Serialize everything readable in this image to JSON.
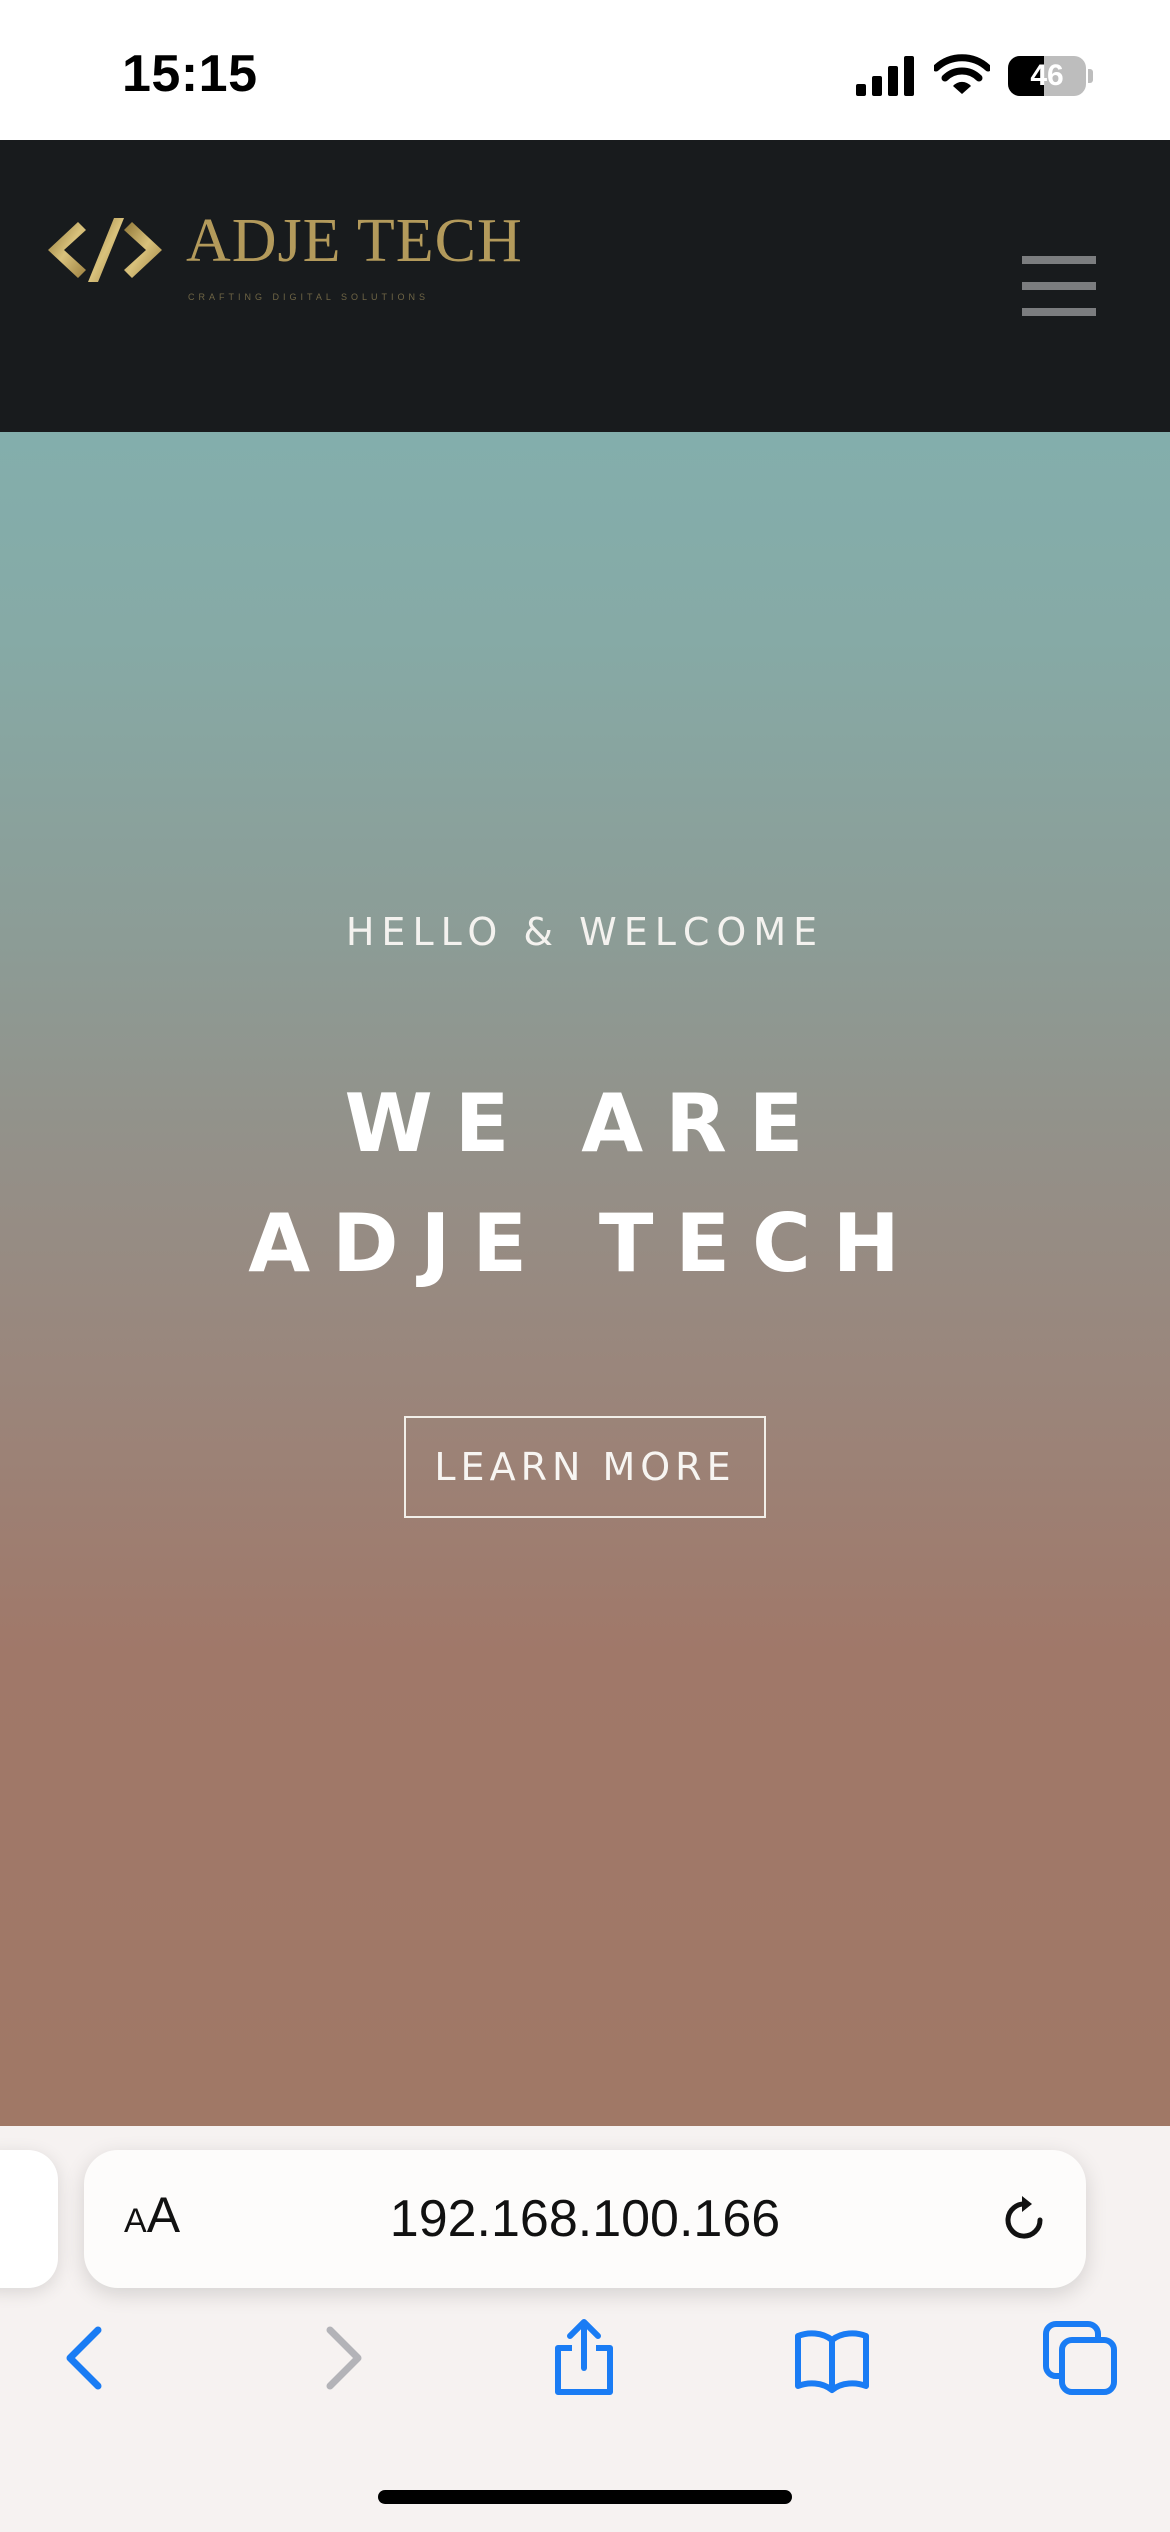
{
  "status_bar": {
    "time": "15:15",
    "battery_level": "46",
    "battery_fraction": 0.46,
    "icons": [
      "signal-icon",
      "wifi-icon",
      "battery-icon"
    ]
  },
  "header": {
    "logo_text": "ADJE TECH",
    "logo_tagline": "CRAFTING DIGITAL SOLUTIONS",
    "logo_icon": "code-brackets-icon",
    "menu_icon": "hamburger-menu-icon",
    "colors": {
      "background": "#181b1d",
      "gold": "#b39a5b",
      "menu": "#7b7d7f"
    }
  },
  "hero": {
    "eyebrow": "HELLO & WELCOME",
    "title": "WE ARE ADJE TECH",
    "cta_label": "LEARN MORE",
    "colors": {
      "top": "#83aeac",
      "bottom": "#a07866"
    }
  },
  "browser": {
    "text_size_small": "A",
    "text_size_big": "A",
    "url": "192.168.100.166",
    "reload_icon": "reload-icon",
    "toolbar": [
      "back-icon",
      "forward-icon",
      "share-icon",
      "bookmarks-icon",
      "tabs-icon"
    ],
    "colors": {
      "accent": "#1a7cf4",
      "disabled": "#b3b3b8"
    }
  }
}
